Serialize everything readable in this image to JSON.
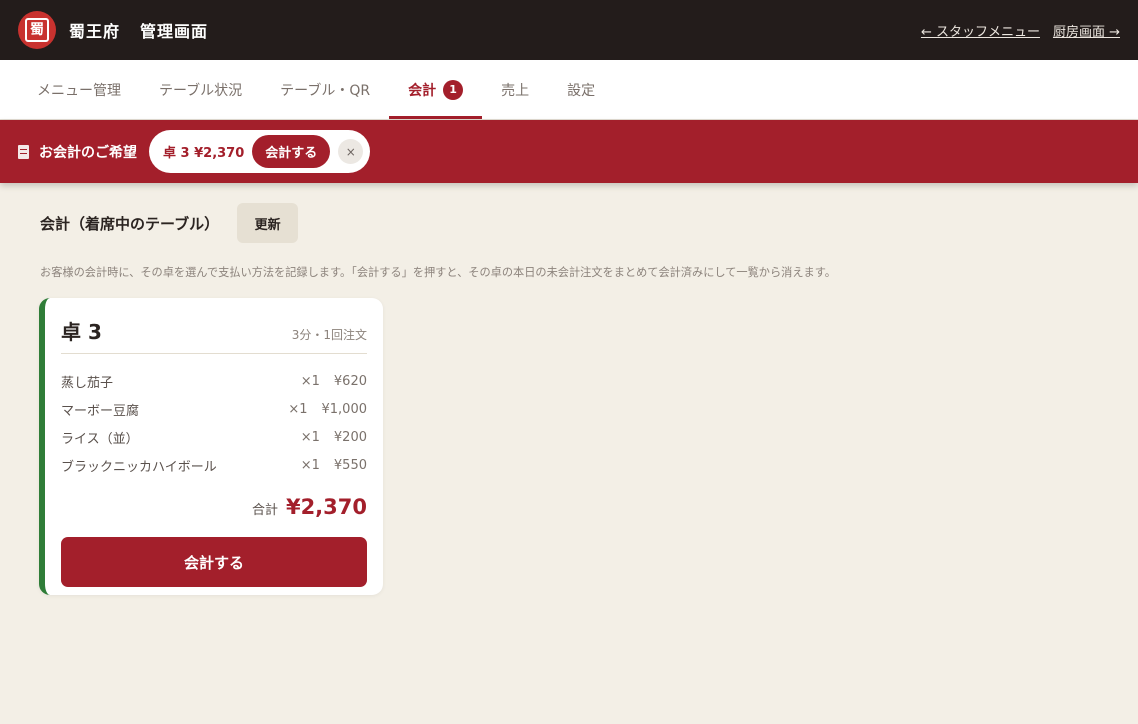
{
  "header": {
    "brand": "蜀王府",
    "subtitle": "管理画面",
    "links": [
      "← スタッフメニュー",
      "厨房画面 →"
    ]
  },
  "tabs": [
    {
      "label": "メニュー管理"
    },
    {
      "label": "テーブル状況"
    },
    {
      "label": "テーブル・QR"
    },
    {
      "label": "会計",
      "badge": "1",
      "active": true
    },
    {
      "label": "売上"
    },
    {
      "label": "設定"
    }
  ],
  "banner": {
    "title": "お会計のご希望",
    "request_text": "卓 3 ¥2,370",
    "request_button": "会計する",
    "close_icon": "×"
  },
  "main": {
    "title": "会計（着席中のテーブル）",
    "refresh_label": "更新",
    "hint": "お客様の会計時に、その卓を選んで支払い方法を記録します。「会計する」を押すと、その卓の本日の未会計注文をまとめて会計済みにして一覧から消えます。"
  },
  "card": {
    "table": "卓 3",
    "meta": "3分・1回注文",
    "items": [
      {
        "name": "蒸し茄子",
        "qty": "×1",
        "price": "¥620"
      },
      {
        "name": "マーボー豆腐",
        "qty": "×1",
        "price": "¥1,000"
      },
      {
        "name": "ライス（並）",
        "qty": "×1",
        "price": "¥200"
      },
      {
        "name": "ブラックニッカハイボール",
        "qty": "×1",
        "price": "¥550"
      }
    ],
    "total_label": "合計",
    "total_value": "¥2,370",
    "checkout_label": "会計する",
    "accent": "#2f7d38"
  },
  "colors": {
    "primary": "#a31f2b",
    "header_bg": "#231c1b",
    "background": "#f3efe6"
  }
}
